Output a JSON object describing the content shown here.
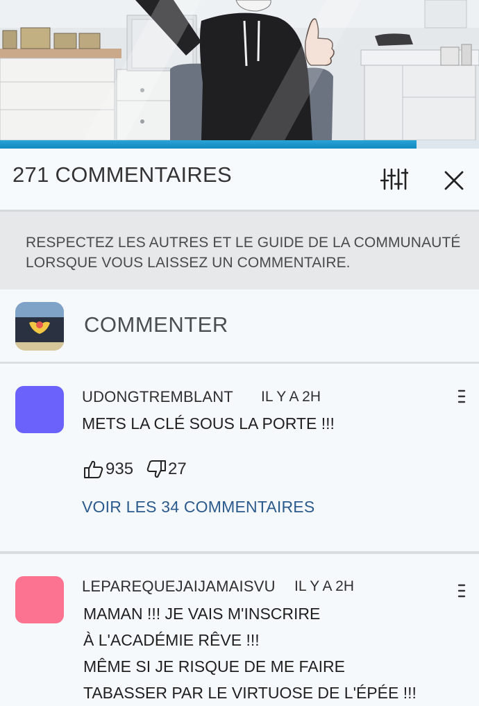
{
  "reading_progress_percent": 87,
  "header": {
    "title": "271 COMMENTAIRES",
    "sort_icon": "sort-sliders-icon",
    "close_icon": "close-icon"
  },
  "notice": {
    "text": "RESPECTEZ LES AUTRES ET LE GUIDE DE LA COMMUNAUTÉ LORSQUE VOUS LAISSEZ UN COMMENTAIRE."
  },
  "compose": {
    "placeholder": "COMMENTER"
  },
  "comments": [
    {
      "username": "UDONGTREMBLANT",
      "time": "IL Y A 2H",
      "lines": [
        "METS LA CLÉ SOUS LA PORTE !!!"
      ],
      "likes": "935",
      "dislikes": "27",
      "replies_label": "VOIR LES 34 COMMENTAIRES",
      "avatar_color": "#6a62fb"
    },
    {
      "username": "LEPAREQUEJAIJAMAISVU",
      "time": "IL Y A 2H",
      "lines": [
        "MAMAN !!! JE VAIS M'INSCRIRE",
        "À L'ACADÉMIE RÊVE !!!",
        "MÊME SI JE RISQUE DE ME FAIRE",
        "TABASSER PAR LE VIRTUOSE DE L'ÉPÉE !!!"
      ],
      "avatar_color": "#fb7390"
    }
  ],
  "colors": {
    "accent": "#1a8fc8",
    "link": "#2b5a8c"
  }
}
